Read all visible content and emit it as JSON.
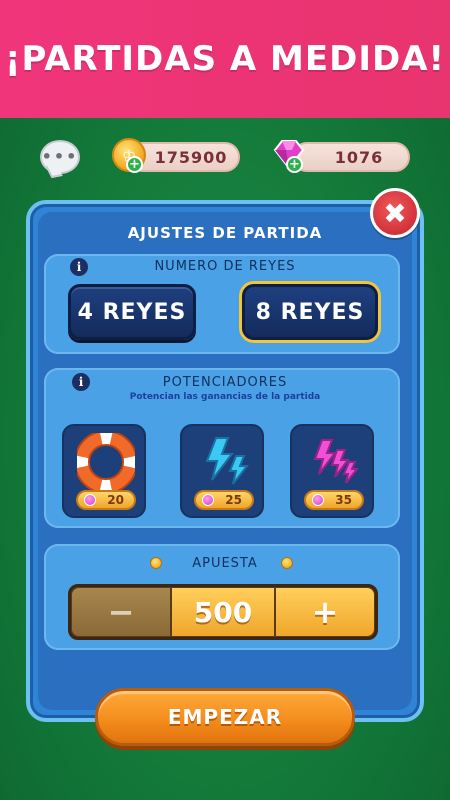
{
  "banner": {
    "title": "¡PARTIDAS A MEDIDA!"
  },
  "topbar": {
    "chat_icon": "chat-bubble-icon",
    "coins": {
      "icon": "coin-icon",
      "value": "175900"
    },
    "gems": {
      "icon": "gem-icon",
      "value": "1076"
    }
  },
  "panel": {
    "title": "AJUSTES DE PARTIDA",
    "close_icon": "close-icon",
    "reyes": {
      "label": "NUMERO DE REYES",
      "options": [
        "4 REYES",
        "8 REYES"
      ],
      "selected": "8 REYES"
    },
    "potenciadores": {
      "label": "POTENCIADORES",
      "subtitle": "Potencian las ganancias de la partida",
      "items": [
        {
          "icon": "lifebuoy-icon",
          "price": "20"
        },
        {
          "icon": "blue-lightning-icon",
          "price": "25"
        },
        {
          "icon": "pink-lightning-icon",
          "price": "35"
        }
      ]
    },
    "apuesta": {
      "label": "APUESTA",
      "minus": "−",
      "value": "500",
      "plus": "+"
    }
  },
  "start_button": "EMPEZAR",
  "colors": {
    "banner": "#f0357a",
    "background": "#137a3a",
    "panel": "#2f84d6",
    "start": "#f28a1a",
    "close": "#d2313b"
  }
}
